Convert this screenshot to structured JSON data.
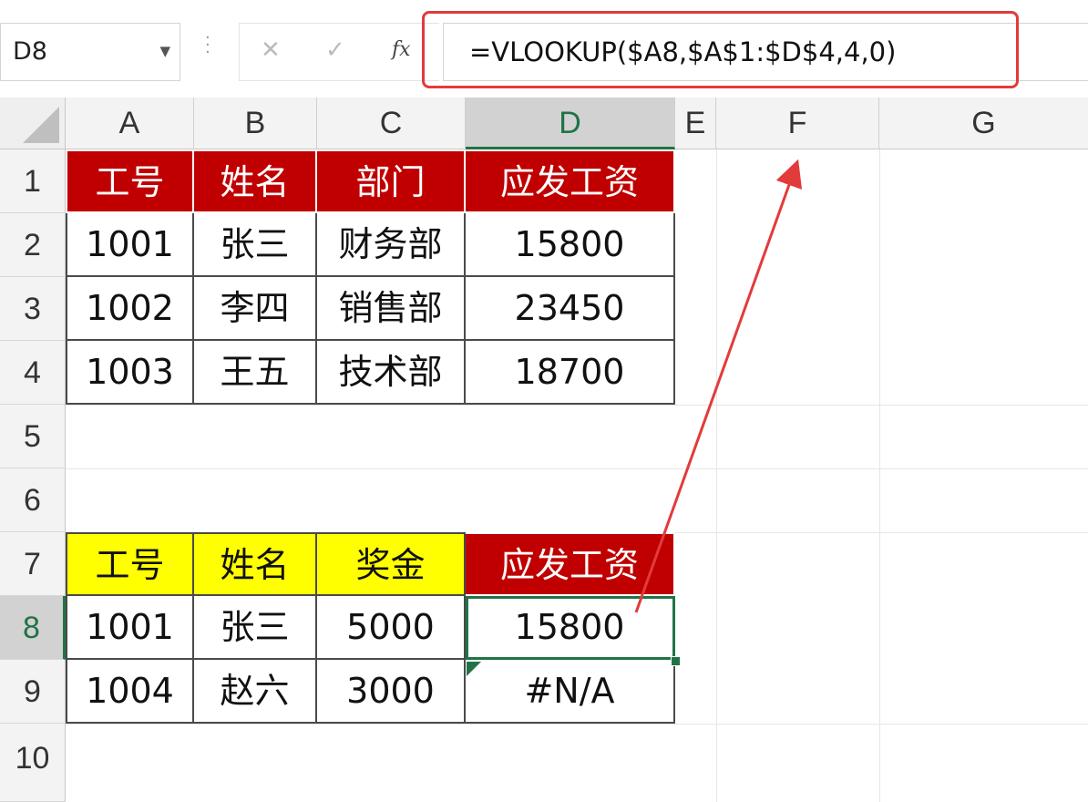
{
  "formula_bar": {
    "name_box": "D8",
    "cancel_symbol": "✕",
    "enter_symbol": "✓",
    "fx_label": "fx",
    "formula": "=VLOOKUP($A8,$A$1:$D$4,4,0)"
  },
  "columns": [
    "A",
    "B",
    "C",
    "D",
    "E",
    "F",
    "G"
  ],
  "rows": [
    "1",
    "2",
    "3",
    "4",
    "5",
    "6",
    "7",
    "8",
    "9",
    "10"
  ],
  "table1": {
    "headers": [
      "工号",
      "姓名",
      "部门",
      "应发工资"
    ],
    "rows": [
      [
        "1001",
        "张三",
        "财务部",
        "15800"
      ],
      [
        "1002",
        "李四",
        "销售部",
        "23450"
      ],
      [
        "1003",
        "王五",
        "技术部",
        "18700"
      ]
    ]
  },
  "table2": {
    "headers": [
      "工号",
      "姓名",
      "奖金",
      "应发工资"
    ],
    "rows": [
      [
        "1001",
        "张三",
        "5000",
        "15800"
      ],
      [
        "1004",
        "赵六",
        "3000",
        "#N/A"
      ]
    ]
  },
  "active_cell": "D8",
  "colors": {
    "header_red": "#c00000",
    "header_yellow": "#ffff00",
    "annotation_red": "#e23b3b",
    "selection_green": "#217346"
  }
}
